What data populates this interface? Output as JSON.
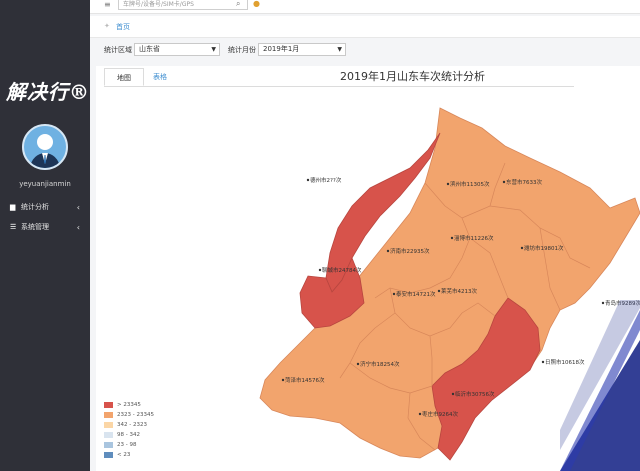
{
  "sidebar": {
    "logo": "解决行®",
    "username": "yeyuanjianmin",
    "nav": [
      {
        "icon": "bar-chart-icon",
        "label": "统计分析"
      },
      {
        "icon": "list-icon",
        "label": "系统管理"
      }
    ]
  },
  "header": {
    "search_placeholder": "车牌号/设备号/SIM卡/GPS"
  },
  "breadcrumb": {
    "home": "首页"
  },
  "filters": {
    "region_label": "统计区域",
    "region_value": "山东省",
    "month_label": "统计月份",
    "month_value": "2019年1月"
  },
  "tabs": [
    {
      "label": "地图",
      "active": true
    },
    {
      "label": "表格",
      "active": false
    }
  ],
  "chart_title": "2019年1月山东车次统计分析",
  "colors": {
    "level1": "#d7534b",
    "level2": "#f2a46d",
    "level3": "#fbd6a6",
    "level4": "#d9e4ef",
    "level5": "#a9c5df",
    "level6": "#5f8dbd",
    "sidebar_bg": "#2f3038",
    "accent": "#3e8ed0"
  },
  "legend": [
    {
      "label": "> 23345",
      "color": "#d7534b"
    },
    {
      "label": "2323 - 23345",
      "color": "#f2a46d"
    },
    {
      "label": "342 - 2323",
      "color": "#fbd6a6"
    },
    {
      "label": "98 - 342",
      "color": "#d9e4ef"
    },
    {
      "label": "23 - 98",
      "color": "#a9c5df"
    },
    {
      "label": "< 23",
      "color": "#5f8dbd"
    }
  ],
  "cities": [
    {
      "name": "德州市",
      "value": "2??次",
      "level": 1
    },
    {
      "name": "聊城市",
      "value": "24784次",
      "level": 1
    },
    {
      "name": "滨州市",
      "value": "11305次",
      "level": 2
    },
    {
      "name": "东营市",
      "value": "7633次",
      "level": 2
    },
    {
      "name": "济南市",
      "value": "22935次",
      "level": 2
    },
    {
      "name": "淄博市",
      "value": "11226次",
      "level": 2
    },
    {
      "name": "潍坊市",
      "value": "19801次",
      "level": 2
    },
    {
      "name": "泰安市",
      "value": "14721次",
      "level": 2
    },
    {
      "name": "莱芜市",
      "value": "4213次",
      "level": 2
    },
    {
      "name": "青岛市",
      "value": "9289次",
      "level": 2
    },
    {
      "name": "济宁市",
      "value": "18254次",
      "level": 2
    },
    {
      "name": "菏泽市",
      "value": "14576次",
      "level": 2
    },
    {
      "name": "日照市",
      "value": "10618次",
      "level": 2
    },
    {
      "name": "临沂市",
      "value": "30756次",
      "level": 1
    },
    {
      "name": "枣庄市",
      "value": "9264次",
      "level": 2
    }
  ]
}
